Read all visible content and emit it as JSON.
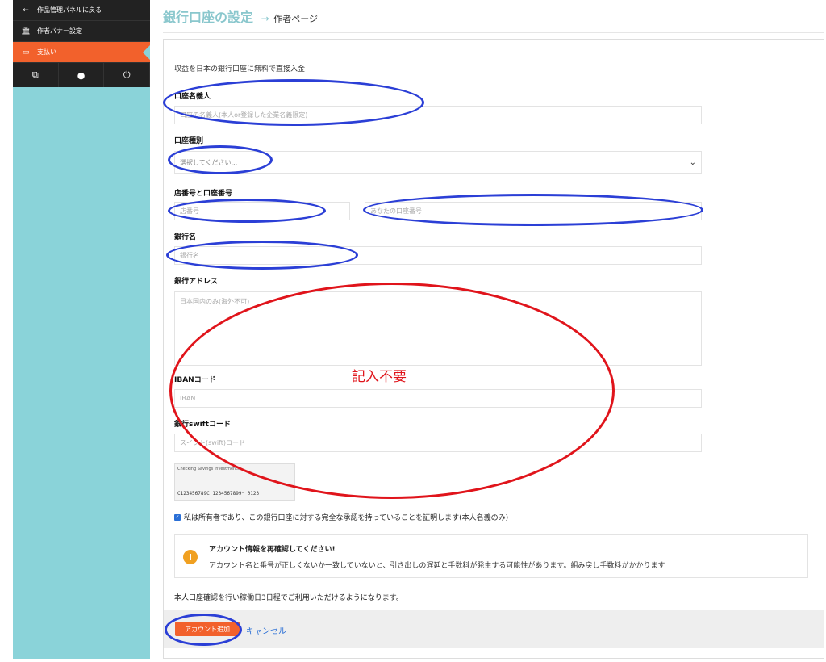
{
  "sidebar": {
    "items": [
      {
        "icon": "←",
        "label": "作品管理パネルに戻る"
      },
      {
        "icon": "🏛",
        "label": "作者バナー設定"
      },
      {
        "icon": "▭",
        "label": "支払い"
      }
    ],
    "bottom_icons": [
      "⧉",
      "●",
      "⏻"
    ]
  },
  "header": {
    "title": "銀行口座の設定",
    "arrow": "→",
    "sub": "作者ページ"
  },
  "form": {
    "intro": "収益を日本の銀行口座に無料で直接入金",
    "account_name_label": "口座名義人",
    "account_name_placeholder": "口座の名義人(本人or登録した企業名義限定)",
    "account_type_label": "口座種別",
    "account_type_selected": "選択してください...",
    "branch_label": "店番号と口座番号",
    "branch_placeholder": "店番号",
    "account_no_placeholder": "あなたの口座番号",
    "bank_name_label": "銀行名",
    "bank_name_placeholder": "銀行名",
    "bank_address_label": "銀行アドレス",
    "bank_address_placeholder": "日本国内のみ(海外不可)",
    "iban_label": "IBANコード",
    "iban_placeholder": "IBAN",
    "swift_label": "銀行swiftコード",
    "swift_placeholder": "スイフト(swift)コード",
    "cheque_bank": "Checking Savings Investments",
    "cheque_micr": "C123456789C  1234567899ᵉ  0123",
    "confirm_text": "私は所有者であり、この銀行口座に対する完全な承認を持っていることを証明します(本人名義のみ)",
    "alert_title": "アカウント情報を再確認してください!",
    "alert_body": "アカウント名と番号が正しくないか一致していないと、引き出しの遅延と手数料が発生する可能性があります。組み戻し手数料がかかります",
    "note": "本人口座確認を行い稼働日3日程でご利用いただけるようになります。",
    "add_button": "アカウント追加",
    "cancel_link": "キャンセル"
  },
  "annotation": {
    "text": "記入不要"
  },
  "colors": {
    "accent": "#f2612c",
    "sidebar_bg": "#8ad3d9",
    "title": "#8ac7cd",
    "blue_mark": "#2b3fd6",
    "red_mark": "#e0141b"
  }
}
